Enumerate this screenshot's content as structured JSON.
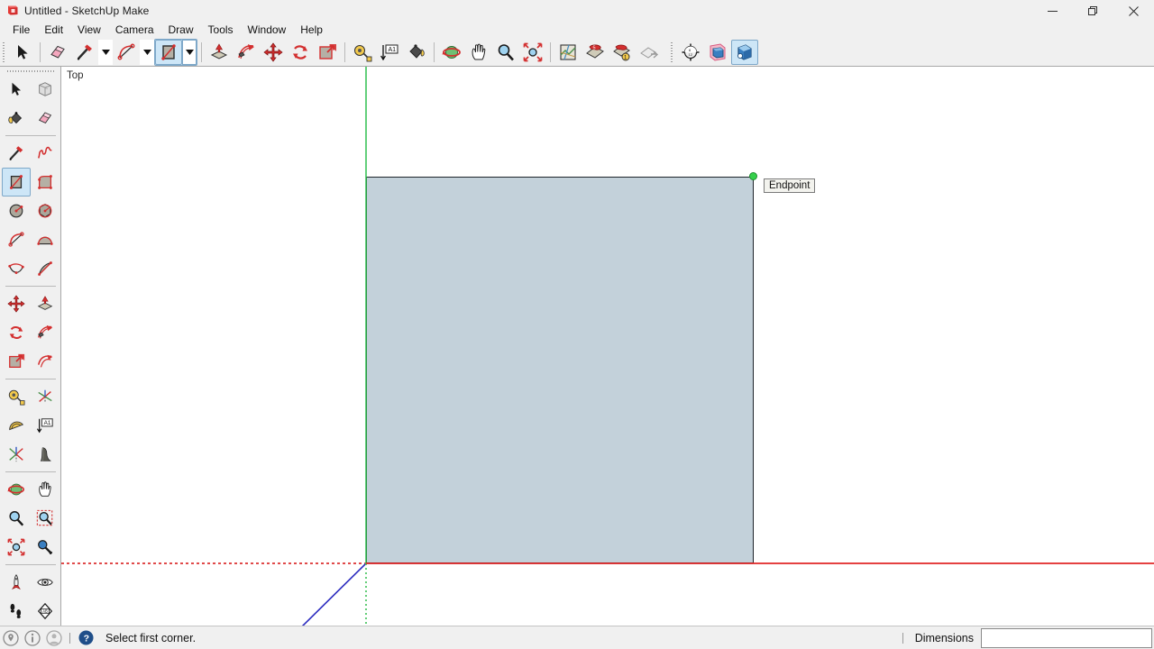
{
  "window": {
    "title": "Untitled - SketchUp Make",
    "logo_icon": "sketchup-logo-icon",
    "controls": [
      {
        "name": "minimize",
        "glyph": "—"
      },
      {
        "name": "restore",
        "glyph": "❐"
      },
      {
        "name": "close",
        "glyph": "✕"
      }
    ]
  },
  "menubar": {
    "items": [
      {
        "label": "File"
      },
      {
        "label": "Edit"
      },
      {
        "label": "View"
      },
      {
        "label": "Camera"
      },
      {
        "label": "Draw"
      },
      {
        "label": "Tools"
      },
      {
        "label": "Window"
      },
      {
        "label": "Help"
      }
    ]
  },
  "toolbar_top": {
    "items": [
      {
        "name": "select-tool",
        "icon": "arrow-cursor-icon",
        "active": false
      },
      {
        "name": "separator-1",
        "icon": "separator"
      },
      {
        "name": "eraser-tool",
        "icon": "eraser-icon",
        "active": false
      },
      {
        "name": "line-tool",
        "icon": "pencil-line-icon",
        "active": false
      },
      {
        "name": "line-tool-dropdown",
        "icon": "chevron-down-icon"
      },
      {
        "name": "arc-tool",
        "icon": "arc-icon",
        "active": false
      },
      {
        "name": "arc-tool-dropdown",
        "icon": "chevron-down-icon"
      },
      {
        "name": "rectangle-tool",
        "icon": "rectangle-icon",
        "active": true
      },
      {
        "name": "rectangle-tool-dropdown",
        "icon": "chevron-down-icon"
      },
      {
        "name": "separator-2",
        "icon": "separator"
      },
      {
        "name": "pushpull-tool",
        "icon": "push-pull-icon",
        "active": false
      },
      {
        "name": "followme-tool",
        "icon": "follow-me-icon",
        "active": false
      },
      {
        "name": "move-tool",
        "icon": "move-arrows-icon",
        "active": false
      },
      {
        "name": "rotate-tool",
        "icon": "rotate-icon",
        "active": false
      },
      {
        "name": "scale-tool",
        "icon": "scale-icon",
        "active": false
      },
      {
        "name": "separator-3",
        "icon": "separator"
      },
      {
        "name": "tape-measure-tool",
        "icon": "tape-measure-icon",
        "active": false
      },
      {
        "name": "dimension-tool",
        "icon": "dimension-a1-icon",
        "active": false
      },
      {
        "name": "paint-bucket-tool",
        "icon": "paint-bucket-icon",
        "active": false
      },
      {
        "name": "separator-4",
        "icon": "separator"
      },
      {
        "name": "orbit-tool",
        "icon": "orbit-icon",
        "active": false
      },
      {
        "name": "pan-tool",
        "icon": "hand-pan-icon",
        "active": false
      },
      {
        "name": "zoom-tool",
        "icon": "magnifier-icon",
        "active": false
      },
      {
        "name": "zoom-extents-tool",
        "icon": "zoom-extents-icon",
        "active": false
      },
      {
        "name": "separator-5",
        "icon": "separator"
      },
      {
        "name": "add-location-tool",
        "icon": "map-location-icon",
        "active": false
      },
      {
        "name": "photo-texture-tool",
        "icon": "photo-texture-icon",
        "active": false
      },
      {
        "name": "toggle-terrain-tool",
        "icon": "terrain-toggle-icon",
        "active": false
      },
      {
        "name": "share-model-tool",
        "icon": "share-model-icon",
        "active": false
      },
      {
        "name": "separator-6",
        "icon": "separator"
      },
      {
        "name": "shadow-settings-tool",
        "icon": "sun-shadow-icon",
        "active": false
      },
      {
        "name": "3d-warehouse-tool",
        "icon": "warehouse-box-icon",
        "active": false
      },
      {
        "name": "extension-warehouse-tool",
        "icon": "extension-box-icon",
        "active": true
      }
    ]
  },
  "toolbar_left": {
    "rows": [
      {
        "type": "tools",
        "items": [
          {
            "name": "select-tool",
            "icon": "arrow-cursor-icon",
            "active": false
          },
          {
            "name": "make-component-tool",
            "icon": "component-cube-icon",
            "active": false
          }
        ]
      },
      {
        "type": "tools",
        "items": [
          {
            "name": "paint-bucket-tool",
            "icon": "paint-bucket-icon",
            "active": false
          },
          {
            "name": "eraser-tool",
            "icon": "eraser-icon",
            "active": false
          }
        ]
      },
      {
        "type": "separator"
      },
      {
        "type": "tools",
        "items": [
          {
            "name": "line-tool",
            "icon": "pencil-line-icon",
            "active": false
          },
          {
            "name": "freehand-tool",
            "icon": "freehand-squiggle-icon",
            "active": false
          }
        ]
      },
      {
        "type": "tools",
        "items": [
          {
            "name": "rectangle-tool",
            "icon": "rectangle-icon",
            "active": true
          },
          {
            "name": "rotated-rectangle-tool",
            "icon": "rotated-rectangle-icon",
            "active": false
          }
        ]
      },
      {
        "type": "tools",
        "items": [
          {
            "name": "circle-tool",
            "icon": "circle-icon",
            "active": false
          },
          {
            "name": "polygon-tool",
            "icon": "polygon-icon",
            "active": false
          }
        ]
      },
      {
        "type": "tools",
        "items": [
          {
            "name": "arc-tool",
            "icon": "arc-icon",
            "active": false
          },
          {
            "name": "two-point-arc-tool",
            "icon": "two-point-arc-icon",
            "active": false
          }
        ]
      },
      {
        "type": "tools",
        "items": [
          {
            "name": "three-point-arc-tool",
            "icon": "three-point-arc-icon",
            "active": false
          },
          {
            "name": "pie-tool",
            "icon": "pie-icon",
            "active": false
          }
        ]
      },
      {
        "type": "separator"
      },
      {
        "type": "tools",
        "items": [
          {
            "name": "move-tool",
            "icon": "move-arrows-icon",
            "active": false
          },
          {
            "name": "pushpull-tool",
            "icon": "push-pull-icon",
            "active": false
          }
        ]
      },
      {
        "type": "tools",
        "items": [
          {
            "name": "rotate-tool",
            "icon": "rotate-icon",
            "active": false
          },
          {
            "name": "followme-tool",
            "icon": "follow-me-icon",
            "active": false
          }
        ]
      },
      {
        "type": "tools",
        "items": [
          {
            "name": "scale-tool",
            "icon": "scale-icon",
            "active": false
          },
          {
            "name": "offset-tool",
            "icon": "offset-icon",
            "active": false
          }
        ]
      },
      {
        "type": "separator"
      },
      {
        "type": "tools",
        "items": [
          {
            "name": "tape-measure-tool",
            "icon": "tape-measure-icon",
            "active": false
          },
          {
            "name": "axes-tool",
            "icon": "axes-cross-icon",
            "active": false
          }
        ]
      },
      {
        "type": "tools",
        "items": [
          {
            "name": "protractor-tool",
            "icon": "protractor-icon",
            "active": false
          },
          {
            "name": "dimension-tool",
            "icon": "dimension-a1-icon",
            "active": false
          }
        ]
      },
      {
        "type": "tools",
        "items": [
          {
            "name": "text-tool",
            "icon": "text-leader-icon",
            "active": false
          },
          {
            "name": "3d-text-tool",
            "icon": "three-d-text-icon",
            "active": false
          }
        ]
      },
      {
        "type": "separator"
      },
      {
        "type": "tools",
        "items": [
          {
            "name": "orbit-tool",
            "icon": "orbit-icon",
            "active": false
          },
          {
            "name": "pan-tool",
            "icon": "hand-pan-icon",
            "active": false
          }
        ]
      },
      {
        "type": "tools",
        "items": [
          {
            "name": "zoom-tool",
            "icon": "magnifier-icon",
            "active": false
          },
          {
            "name": "zoom-window-tool",
            "icon": "zoom-window-icon",
            "active": false
          }
        ]
      },
      {
        "type": "tools",
        "items": [
          {
            "name": "zoom-extents-tool",
            "icon": "zoom-extents-icon",
            "active": false
          },
          {
            "name": "previous-view-tool",
            "icon": "previous-view-icon",
            "active": false
          }
        ]
      },
      {
        "type": "separator"
      },
      {
        "type": "tools",
        "items": [
          {
            "name": "position-camera-tool",
            "icon": "position-camera-icon",
            "active": false
          },
          {
            "name": "look-around-tool",
            "icon": "eye-look-around-icon",
            "active": false
          }
        ]
      },
      {
        "type": "tools",
        "items": [
          {
            "name": "walk-tool",
            "icon": "footprints-walk-icon",
            "active": false
          },
          {
            "name": "section-plane-tool",
            "icon": "section-plane-icon",
            "active": false
          }
        ]
      }
    ]
  },
  "canvas": {
    "view_label": "Top",
    "inference_tooltip": "Endpoint",
    "colors": {
      "face_fill": "#c3d1da",
      "edge": "#1d2429",
      "axis_red": "#e02020",
      "axis_green": "#2fbf4f",
      "axis_blue": "#2b2bbf",
      "endpoint_marker": "#35d04b",
      "background": "#ffffff"
    }
  },
  "statusbar": {
    "left_icons": [
      {
        "name": "geo-location-icon"
      },
      {
        "name": "info-icon"
      },
      {
        "name": "person-account-icon"
      }
    ],
    "help_icon": "help-question-icon",
    "message": "Select first corner.",
    "dimensions_label": "Dimensions",
    "dimensions_value": "",
    "dimensions_placeholder": ""
  }
}
